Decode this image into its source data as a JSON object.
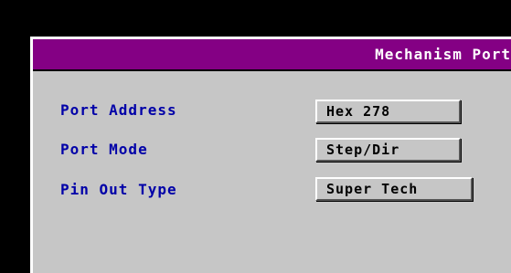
{
  "dialog": {
    "title": "Mechanism Port"
  },
  "fields": [
    {
      "label": "Port Address",
      "value": "Hex 278"
    },
    {
      "label": "Port Mode",
      "value": "Step/Dir"
    },
    {
      "label": "Pin Out Type",
      "value": "Super Tech"
    }
  ],
  "colors": {
    "title_bar": "#840084",
    "label_text": "#0000a8",
    "dialog_bg": "#c6c6c6"
  }
}
